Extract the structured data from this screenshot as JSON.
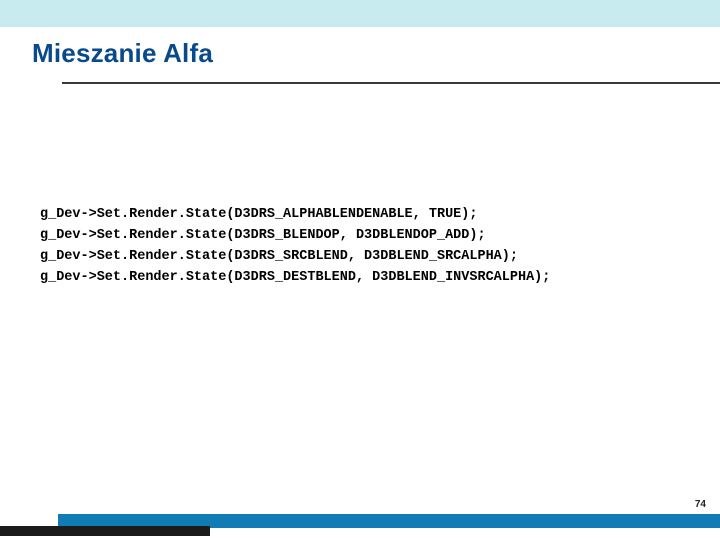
{
  "title": "Mieszanie Alfa",
  "code": {
    "lines": [
      "g_Dev->Set.Render.State(D3DRS_ALPHABLENDENABLE, TRUE);",
      "g_Dev->Set.Render.State(D3DRS_BLENDOP, D3DBLENDOP_ADD);",
      "g_Dev->Set.Render.State(D3DRS_SRCBLEND, D3DBLEND_SRCALPHA);",
      "g_Dev->Set.Render.State(D3DRS_DESTBLEND, D3DBLEND_INVSRCALPHA);"
    ]
  },
  "page_number": "74"
}
